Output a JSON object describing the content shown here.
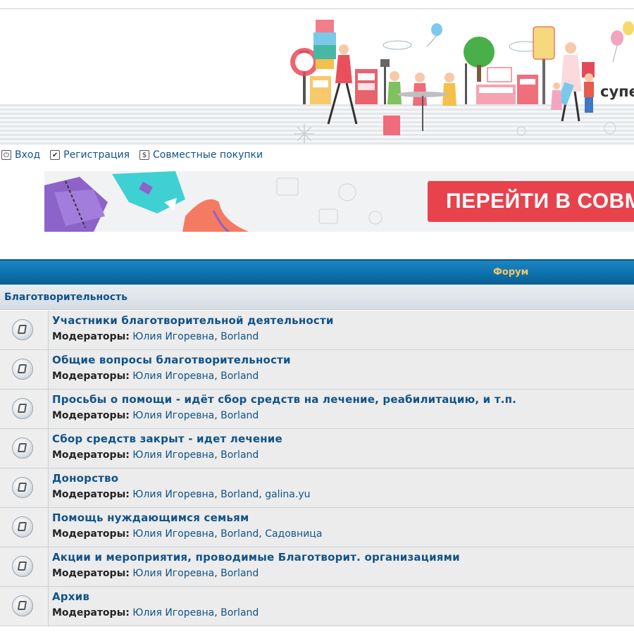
{
  "header": {
    "brand_fragment": "супе"
  },
  "nav": {
    "login": "Вход",
    "register": "Регистрация",
    "joint_purchases": "Совместные покупки"
  },
  "promo": {
    "button_text": "ПЕРЕЙТИ В СОВМ"
  },
  "forum": {
    "column_title": "Форум",
    "category": "Благотворительность",
    "moderators_label": "Модераторы:",
    "rows": [
      {
        "title": "Участники благотворительной деятельности",
        "moderators": [
          "Юлия Игоревна",
          "Borland"
        ]
      },
      {
        "title": "Общие вопросы благотворительности",
        "moderators": [
          "Юлия Игоревна",
          "Borland"
        ]
      },
      {
        "title": "Просьбы о помощи - идёт сбор средств на лечение, реабилитацию, и т.п.",
        "moderators": [
          "Юлия Игоревна",
          "Borland"
        ]
      },
      {
        "title": "Сбор средств закрыт - идет лечение",
        "moderators": [
          "Юлия Игоревна",
          "Borland"
        ]
      },
      {
        "title": "Донорство",
        "moderators": [
          "Юлия Игоревна",
          "Borland",
          "galina.yu"
        ]
      },
      {
        "title": "Помощь нуждающимся семьям",
        "moderators": [
          "Юлия Игоревна",
          "Borland",
          "Садовница"
        ]
      },
      {
        "title": "Акции и мероприятия, проводимые Благотворит. организациями",
        "moderators": [
          "Юлия Игоревна",
          "Borland"
        ]
      },
      {
        "title": "Архив",
        "moderators": [
          "Юлия Игоревна",
          "Borland"
        ]
      }
    ]
  },
  "colors": {
    "link": "#105289",
    "forum_bar": "#0d6fa8",
    "forum_title": "#f4c76a",
    "promo_button": "#e8424d"
  },
  "icons": [
    "login-icon",
    "register-checkbox-icon",
    "dollar-icon",
    "forum-read-icon"
  ]
}
